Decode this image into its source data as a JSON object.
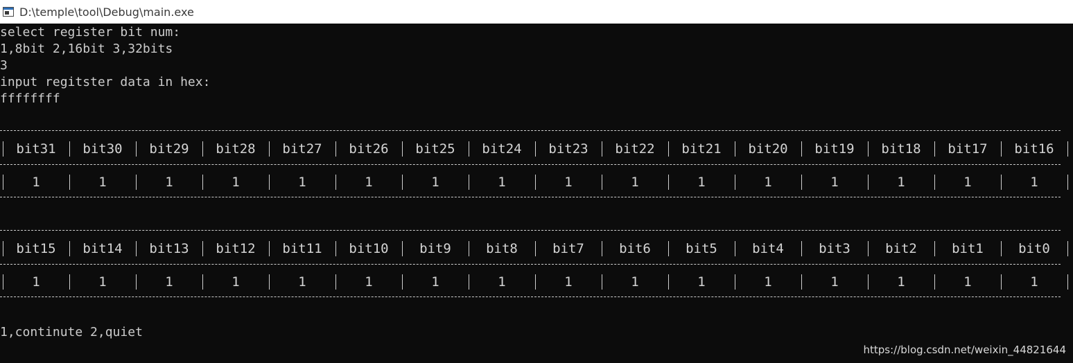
{
  "window": {
    "title": "D:\\temple\\tool\\Debug\\main.exe",
    "icon": "console-app-icon"
  },
  "console": {
    "lines_top": [
      "select register bit num:",
      "1,8bit 2,16bit 3,32bits",
      "3",
      "input regitster data in hex:",
      "ffffffff"
    ],
    "table_high": {
      "headers": [
        "bit31",
        "bit30",
        "bit29",
        "bit28",
        "bit27",
        "bit26",
        "bit25",
        "bit24",
        "bit23",
        "bit22",
        "bit21",
        "bit20",
        "bit19",
        "bit18",
        "bit17",
        "bit16"
      ],
      "values": [
        "1",
        "1",
        "1",
        "1",
        "1",
        "1",
        "1",
        "1",
        "1",
        "1",
        "1",
        "1",
        "1",
        "1",
        "1",
        "1"
      ]
    },
    "table_low": {
      "headers": [
        "bit15",
        "bit14",
        "bit13",
        "bit12",
        "bit11",
        "bit10",
        "bit9",
        "bit8",
        "bit7",
        "bit6",
        "bit5",
        "bit4",
        "bit3",
        "bit2",
        "bit1",
        "bit0"
      ],
      "values": [
        "1",
        "1",
        "1",
        "1",
        "1",
        "1",
        "1",
        "1",
        "1",
        "1",
        "1",
        "1",
        "1",
        "1",
        "1",
        "1"
      ]
    },
    "prompt": "1,continute 2,quiet"
  },
  "watermark": "https://blog.csdn.net/weixin_44821644"
}
